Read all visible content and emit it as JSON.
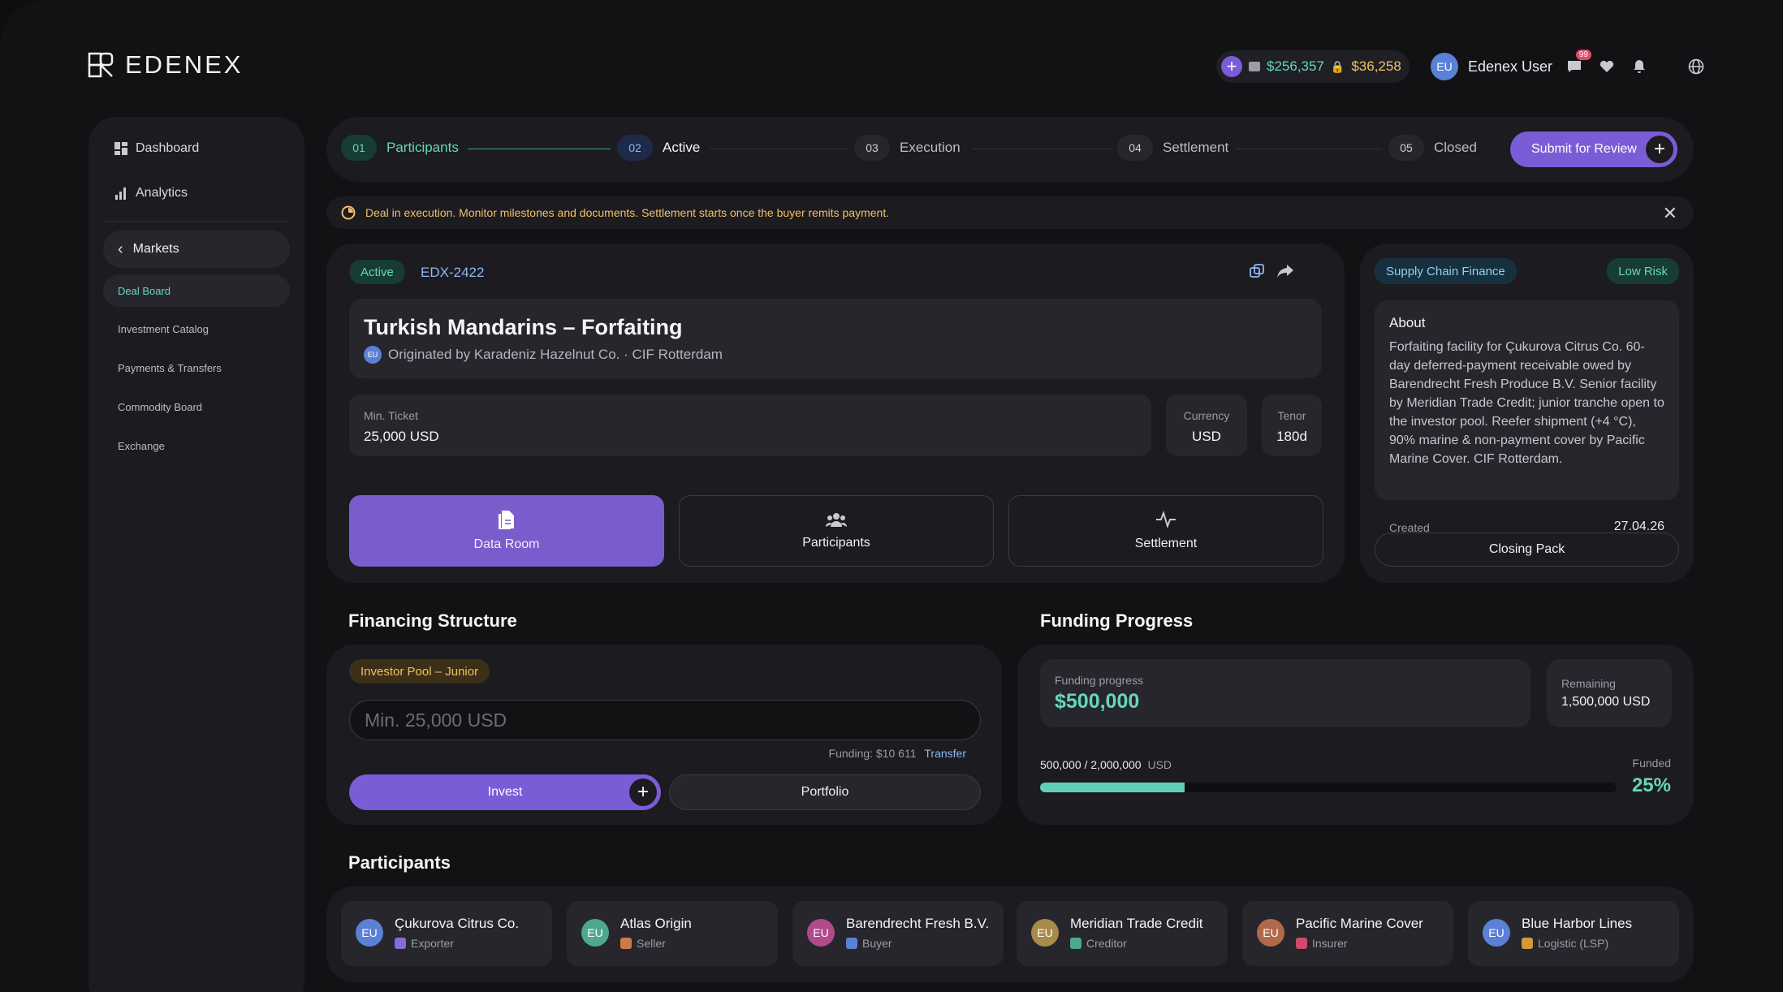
{
  "brand": {
    "name": "EDENEX"
  },
  "header": {
    "balance_primary": "$256,357",
    "balance_locked": "$36,258",
    "user_initials": "EU",
    "user_name": "Edenex User",
    "notif_count": "99"
  },
  "sidebar": {
    "top_items": [
      {
        "label": "Dashboard",
        "icon": "grid-icon"
      },
      {
        "label": "Analytics",
        "icon": "bar-chart-icon"
      }
    ],
    "section": "Markets",
    "active_sub": "Deal Board",
    "sub_items": [
      "Investment Catalog",
      "Payments & Transfers",
      "Commodity Board",
      "Exchange"
    ]
  },
  "stepper": {
    "steps": [
      {
        "num": "01",
        "label": "Participants"
      },
      {
        "num": "02",
        "label": "Active"
      },
      {
        "num": "03",
        "label": "Execution"
      },
      {
        "num": "04",
        "label": "Settlement"
      },
      {
        "num": "05",
        "label": "Closed"
      }
    ],
    "submit": "Submit for Review"
  },
  "alert": {
    "text": "Deal in execution. Monitor milestones and documents. Settlement starts once the buyer remits payment."
  },
  "deal": {
    "status": "Active",
    "id": "EDX-2422",
    "title": "Turkish Mandarins – Forfaiting",
    "originator_initials": "EU",
    "originated": "Originated by Karadeniz Hazelnut Co. · CIF Rotterdam",
    "min_ticket_label": "Min. Ticket",
    "min_ticket": "25,000 USD",
    "currency_label": "Currency",
    "currency": "USD",
    "tenor_label": "Tenor",
    "tenor": "180d",
    "tabs": [
      "Data Room",
      "Participants",
      "Settlement"
    ]
  },
  "side": {
    "category": "Supply Chain Finance",
    "risk": "Low Risk",
    "about_title": "About",
    "about_text": "Forfaiting facility for Çukurova Citrus Co. 60-day deferred-payment receivable owed by Barendrecht Fresh Produce B.V. Senior facility by Meridian Trade Credit; junior tranche open to the investor pool. Reefer shipment (+4 °C), 90% marine & non-payment cover by Pacific Marine Cover. CIF Rotterdam.",
    "created_label": "Created",
    "created": "27.04.26",
    "closing_pack": "Closing Pack"
  },
  "financing": {
    "title": "Financing Structure",
    "tranche": "Investor Pool – Junior",
    "placeholder": "Min. 25,000 USD",
    "funding_text": "Funding: $10 611",
    "transfer": "Transfer",
    "invest": "Invest",
    "portfolio": "Portfolio"
  },
  "progress": {
    "title": "Funding Progress",
    "progress_label": "Funding progress",
    "progress_value": "$500,000",
    "remaining_label": "Remaining",
    "remaining_value": "1,500,000 USD",
    "ratio": "500,000 / 2,000,000",
    "unit": "USD",
    "funded_label": "Funded",
    "funded_pct": "25%",
    "funded_fraction": 0.25
  },
  "participants": {
    "title": "Participants",
    "items": [
      {
        "initials": "EU",
        "name": "Çukurova Citrus Co.",
        "role": "Exporter",
        "color": "#5a80d8",
        "role_color": "#8a6ad8"
      },
      {
        "initials": "EU",
        "name": "Atlas Origin",
        "role": "Seller",
        "color": "#4fa88e",
        "role_color": "#d07a4a"
      },
      {
        "initials": "EU",
        "name": "Barendrecht Fresh B.V.",
        "role": "Buyer",
        "color": "#b04a8a",
        "role_color": "#5a80d8"
      },
      {
        "initials": "EU",
        "name": "Meridian Trade Credit",
        "role": "Creditor",
        "color": "#a88a4a",
        "role_color": "#4fa88e"
      },
      {
        "initials": "EU",
        "name": "Pacific Marine Cover",
        "role": "Insurer",
        "color": "#b06a4a",
        "role_color": "#d04a6a"
      },
      {
        "initials": "EU",
        "name": "Blue Harbor Lines",
        "role": "Logistic (LSP)",
        "color": "#5a80d8",
        "role_color": "#d09a3a"
      }
    ]
  }
}
